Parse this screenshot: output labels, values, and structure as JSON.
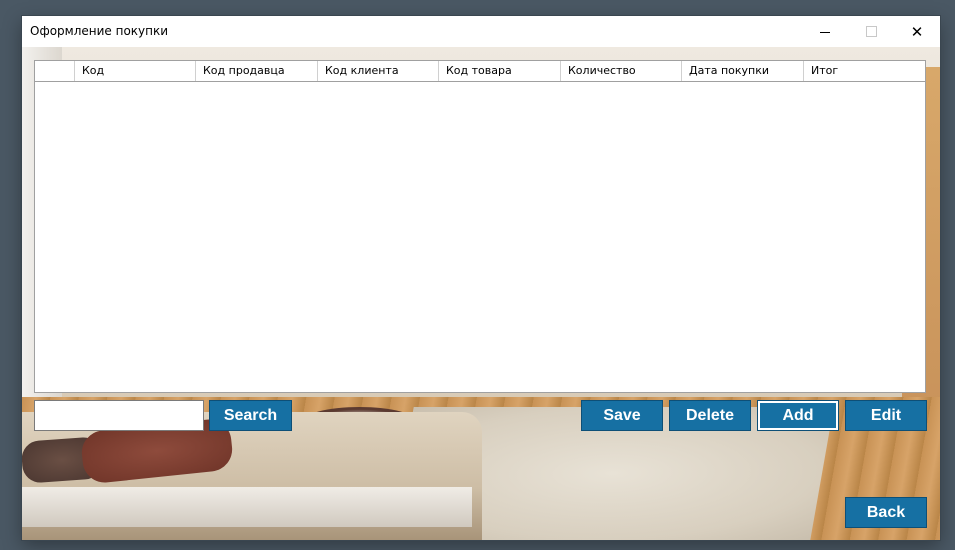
{
  "window": {
    "title": "Оформление покупки",
    "minimize_icon": "minimize-icon",
    "maximize_icon": "maximize-icon",
    "close_icon": "close-icon",
    "close_glyph": "✕"
  },
  "grid": {
    "columns": [
      "Код",
      "Код продавца",
      "Код клиента",
      "Код товара",
      "Количество",
      "Дата покупки",
      "Итог"
    ],
    "rows": []
  },
  "search": {
    "value": "",
    "placeholder": "",
    "button_label": "Search"
  },
  "actions": {
    "save_label": "Save",
    "delete_label": "Delete",
    "add_label": "Add",
    "edit_label": "Edit",
    "back_label": "Back"
  },
  "colors": {
    "button_bg": "#1670a3",
    "button_text": "#ffffff",
    "desktop_bg": "#4a5864"
  }
}
